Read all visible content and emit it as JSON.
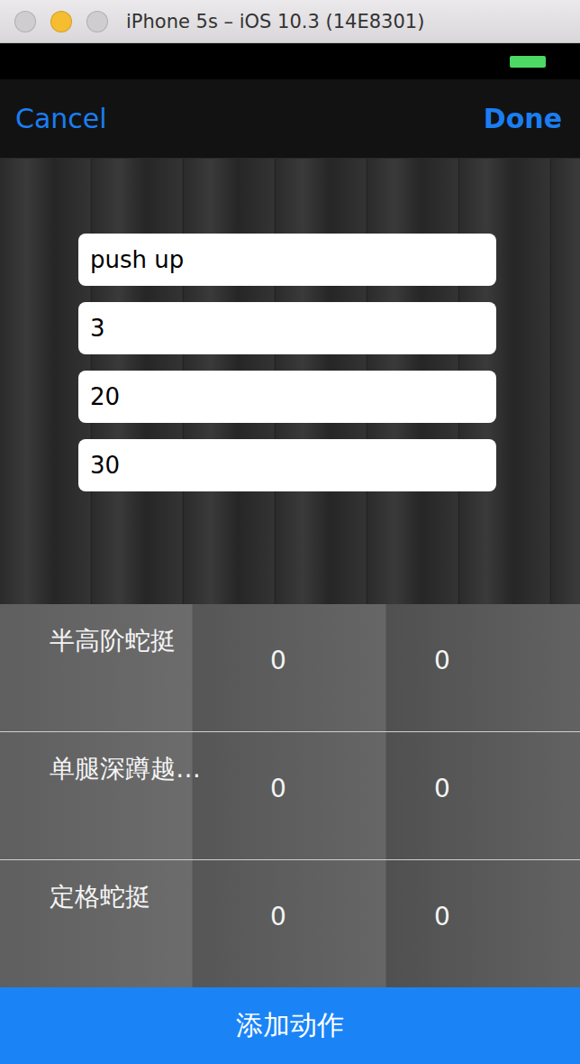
{
  "window": {
    "title": "iPhone 5s – iOS 10.3 (14E8301)"
  },
  "status_bar": {
    "battery": {
      "level": 1
    }
  },
  "nav_bar": {
    "cancel": "Cancel",
    "done": "Done"
  },
  "fields": [
    {
      "value": "push up"
    },
    {
      "value": "3"
    },
    {
      "value": "20"
    },
    {
      "value": "30"
    }
  ],
  "exercises": [
    {
      "name": "半高阶蛇挺",
      "values": [
        "0",
        "0"
      ]
    },
    {
      "name": "单腿深蹲越…",
      "values": [
        "0",
        "0"
      ]
    },
    {
      "name": "定格蛇挺",
      "values": [
        "0",
        "0"
      ]
    }
  ],
  "add_button": "添加动作"
}
